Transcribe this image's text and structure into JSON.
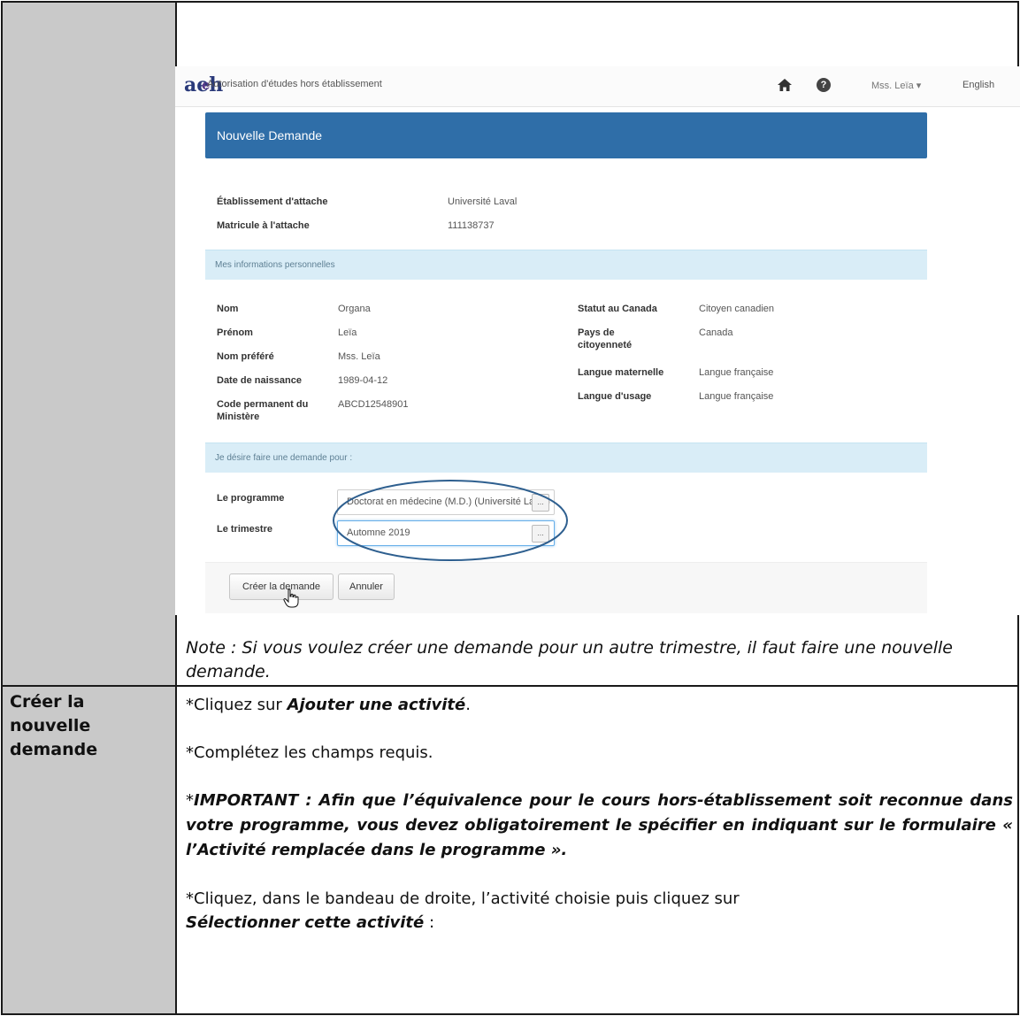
{
  "screenshot": {
    "logo": "aeh",
    "logo_e": "e",
    "app_title": "Autorisation d'études hors établissement",
    "icons": {
      "home": "home-icon",
      "help": "help-icon",
      "cursor": "hand-pointer-icon"
    },
    "user_menu": "Mss. Leïa ▾",
    "language_link": "English",
    "panel_title": "Nouvelle Demande",
    "institution": {
      "label": "Établissement d'attache",
      "value": "Université Laval"
    },
    "student_id": {
      "label": "Matricule à l'attache",
      "value": "111138737"
    },
    "section_personal": "Mes informations personnelles",
    "personal_left": [
      {
        "label": "Nom",
        "value": "Organa"
      },
      {
        "label": "Prénom",
        "value": "Leïa"
      },
      {
        "label": "Nom préféré",
        "value": "Mss. Leïa"
      },
      {
        "label": "Date de naissance",
        "value": "1989-04-12"
      },
      {
        "label": "Code permanent du Ministère",
        "value": "ABCD12548901"
      }
    ],
    "personal_right": [
      {
        "label": "Statut au Canada",
        "value": "Citoyen canadien"
      },
      {
        "label": "Pays de citoyenneté",
        "value": "Canada"
      },
      {
        "label": "Langue maternelle",
        "value": "Langue française"
      },
      {
        "label": "Langue d'usage",
        "value": "Langue française"
      }
    ],
    "section_request": "Je désire faire une demande pour :",
    "program": {
      "label": "Le programme",
      "value": "Doctorat en médecine (M.D.) (Université Laval)",
      "button": "..."
    },
    "term": {
      "label": "Le trimestre",
      "value": "Automne 2019",
      "button": "..."
    },
    "create_button": "Créer la demande",
    "cancel_button": "Annuler",
    "colors": {
      "header_blue": "#2f6ea8",
      "section_bg": "#d9edf7",
      "ellipse": "#2e5f8f"
    }
  },
  "note": "Note : Si vous voulez créer une demande pour un autre trimestre, il faut faire une nouvelle demande.",
  "row_label": "Créer la nouvelle demande",
  "instructions": {
    "step1_prefix": "*Cliquez sur ",
    "step1_emph": "Ajouter une activité",
    "step1_suffix": ".",
    "step2": "*Complétez les champs requis.",
    "important_star": "*",
    "important_text": "IMPORTANT : Afin que l’équivalence pour le cours hors-établissement soit reconnue dans votre programme, vous devez obligatoirement le spécifier en indiquant sur le formulaire « l’Activité remplacée dans le programme ».",
    "step3_line1": "*Cliquez, dans le bandeau de droite, l’activité choisie puis cliquez sur",
    "step3_emph": "Sélectionner cette activité",
    "step3_suffix": " :"
  }
}
